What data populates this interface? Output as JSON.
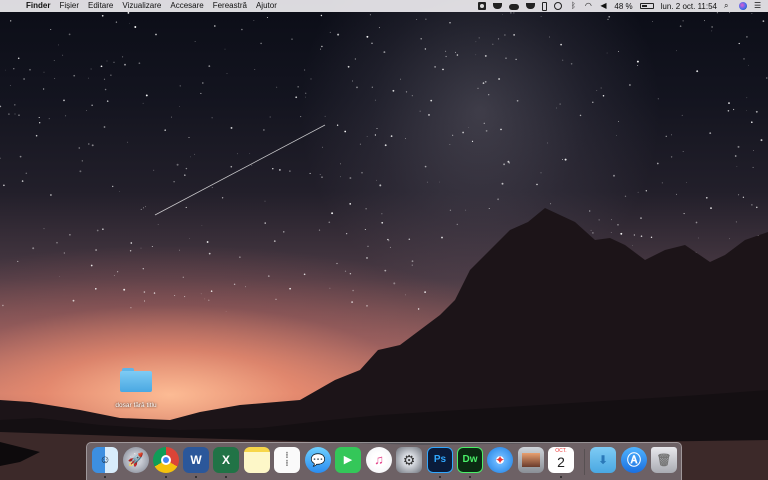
{
  "menubar": {
    "apple_glyph": "",
    "app_name": "Finder",
    "menus": [
      "Fișier",
      "Editare",
      "Vizualizare",
      "Accesare",
      "Fereastră",
      "Ajutor"
    ],
    "battery_percent": "48 %",
    "datetime": "lun. 2 oct.  11:54",
    "status_icons": [
      "camera-icon",
      "creative-cloud-icon",
      "cloud-icon",
      "mask-icon",
      "phone-icon",
      "time-machine-icon",
      "bluetooth-icon",
      "wifi-icon",
      "volume-icon",
      "battery-icon",
      "search-icon",
      "siri-icon",
      "notification-center-icon"
    ]
  },
  "desktop": {
    "folder_label": "dosar fără titlu"
  },
  "dock": {
    "items": [
      {
        "name": "finder",
        "running": true
      },
      {
        "name": "launchpad",
        "running": false
      },
      {
        "name": "chrome",
        "running": true
      },
      {
        "name": "word",
        "running": true
      },
      {
        "name": "excel",
        "running": true
      },
      {
        "name": "notes",
        "running": false
      },
      {
        "name": "reminders",
        "running": false
      },
      {
        "name": "messages",
        "running": false
      },
      {
        "name": "facetime",
        "running": false
      },
      {
        "name": "itunes",
        "running": false
      },
      {
        "name": "system-preferences",
        "running": false
      },
      {
        "name": "photoshop",
        "running": true
      },
      {
        "name": "dreamweaver",
        "running": true
      },
      {
        "name": "safari",
        "running": false
      },
      {
        "name": "preview",
        "running": false
      },
      {
        "name": "calendar",
        "running": true
      },
      {
        "name": "downloads-folder",
        "running": false
      },
      {
        "name": "app-store",
        "running": false
      },
      {
        "name": "trash",
        "running": false
      }
    ],
    "labels": {
      "word": "W",
      "excel": "X",
      "photoshop": "Ps",
      "dreamweaver": "Dw",
      "calendar_day": "2",
      "calendar_month": "OCT."
    },
    "colors": {
      "photoshop": "#0a1b3a",
      "photoshop_text": "#31a8ff",
      "dreamweaver": "#0b2a12",
      "dreamweaver_text": "#4af068",
      "word": "#2b579a",
      "excel": "#217346"
    }
  }
}
